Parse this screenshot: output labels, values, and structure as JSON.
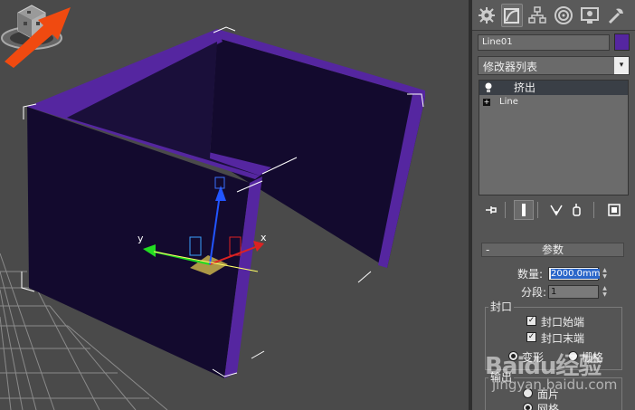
{
  "viewport": {
    "axis_labels": {
      "x": "x",
      "y": "y"
    },
    "colors": {
      "wall_face": "#130a2e",
      "wall_edge": "#5526a0",
      "background": "#4a4a4a"
    }
  },
  "command_panel": {
    "tabs": [
      {
        "icon": "create-icon"
      },
      {
        "icon": "modify-icon",
        "active": true
      },
      {
        "icon": "hierarchy-icon"
      },
      {
        "icon": "motion-icon"
      },
      {
        "icon": "display-icon"
      },
      {
        "icon": "utilities-icon"
      }
    ],
    "object_name": "Line01",
    "object_color": "#5526a0",
    "modifier_list": {
      "label": "修改器列表",
      "arrow": "▾"
    },
    "stack": [
      {
        "label": "挤出",
        "selected": true,
        "icon": "lightbulb-icon"
      },
      {
        "label": "Line",
        "selected": false,
        "icon": "plus-icon",
        "expander": "+"
      }
    ],
    "stack_tools": [
      {
        "icon": "pin-stack-icon"
      },
      {
        "icon": "show-end-result-icon",
        "active": true
      },
      {
        "icon": "make-unique-icon"
      },
      {
        "icon": "remove-modifier-icon"
      },
      {
        "icon": "configure-modifier-sets-icon"
      }
    ],
    "parameters": {
      "title": "参数",
      "collapse": "-",
      "amount_label": "数量:",
      "amount_value": "2000.0mm",
      "segments_label": "分段:",
      "segments_value": "1",
      "spinner_up": "▲",
      "spinner_down": "▼",
      "capping": {
        "title": "封口",
        "cap_start": {
          "label": "封口始端",
          "checked": true,
          "mark": "✓"
        },
        "cap_end": {
          "label": "封口末端",
          "checked": true,
          "mark": "✓"
        },
        "morph": {
          "label": "变形",
          "selected": true
        },
        "grid": {
          "label": "栅格",
          "selected": false
        }
      },
      "output": {
        "title": "输出",
        "patch": {
          "label": "面片",
          "selected": false
        },
        "mesh": {
          "label": "网格",
          "selected": true
        }
      }
    }
  },
  "annotation": {
    "color": "#f04a10"
  },
  "watermark": {
    "brand": "Baidu经验",
    "url": "jingyan.baidu.com"
  }
}
